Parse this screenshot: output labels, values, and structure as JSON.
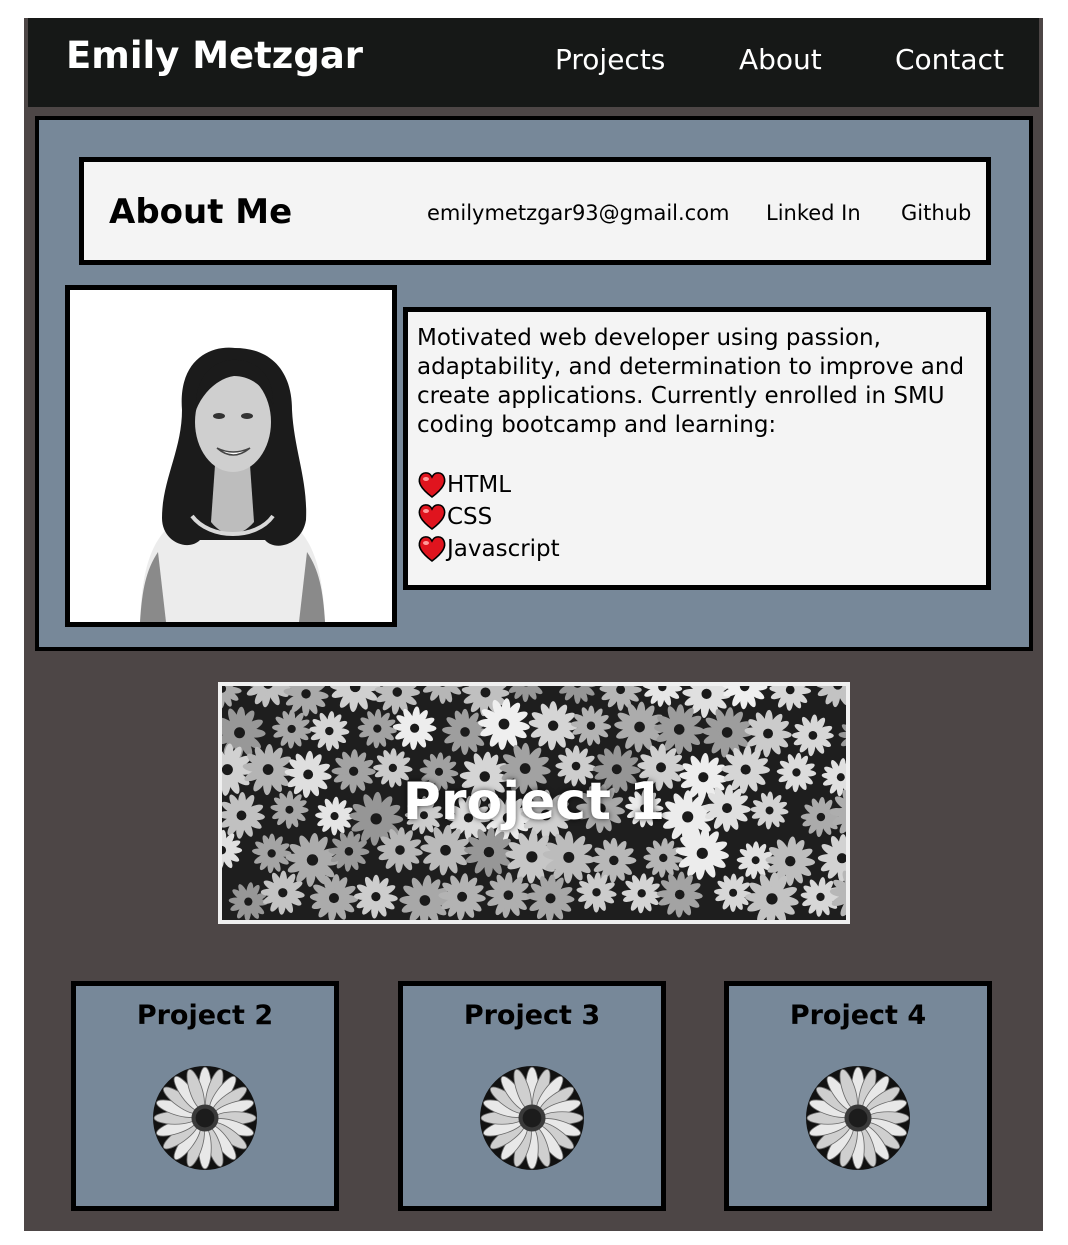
{
  "nav": {
    "brand": "Emily Metzgar",
    "links": [
      "Projects",
      "About",
      "Contact"
    ]
  },
  "about": {
    "title": "About Me",
    "email": "emilymetzgar93@gmail.com",
    "linkedin": "Linked In",
    "github": "Github",
    "photo_alt": "Portrait photo of Emily Metzgar",
    "bio": "Motivated web developer using passion, adaptability, and determination to improve and create applications. Currently enrolled in SMU coding bootcamp and learning:",
    "skills": [
      "HTML",
      "CSS",
      "Javascript"
    ]
  },
  "projects": {
    "featured": "Project 1",
    "cards": [
      "Project 2",
      "Project 3",
      "Project 4"
    ]
  },
  "colors": {
    "nav_bg": "#161817",
    "page_bg": "#4d4646",
    "section_bg": "#778899",
    "box_bg": "#f4f4f4",
    "heart": "#e0141e"
  },
  "icons": {
    "skill_bullet": "heart-icon",
    "card_image": "daisy-icon"
  }
}
